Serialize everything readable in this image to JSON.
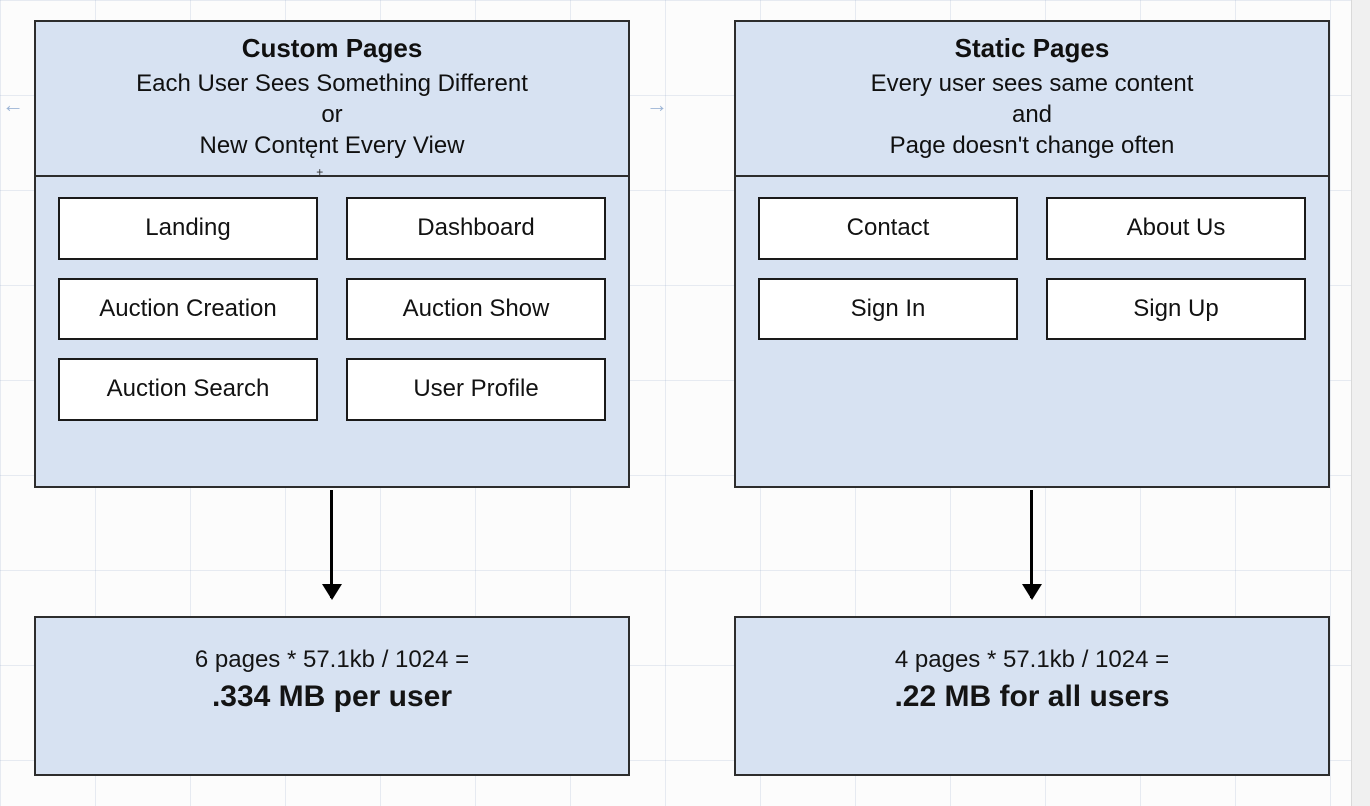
{
  "colors": {
    "panel_fill": "#d7e2f2",
    "panel_border": "#2d2d2d",
    "page_box_fill": "#ffffff",
    "page_box_border": "#1a1a1a",
    "text": "#101010"
  },
  "left": {
    "title": "Custom Pages",
    "sub_line1": "Each User Sees Something Different",
    "sub_or": "or",
    "sub_line2_a": "New Cont",
    "sub_line2_b": "nt Every View",
    "sub_caret_char": "ę",
    "pages": [
      "Landing",
      "Dashboard",
      "Auction Creation",
      "Auction Show",
      "Auction Search",
      "User Profile"
    ],
    "calc_formula": "6 pages * 57.1kb / 1024 =",
    "calc_result": ".334 MB per user"
  },
  "right": {
    "title": "Static Pages",
    "sub_line1": "Every user sees same content",
    "sub_and": "and",
    "sub_line2": "Page doesn't change often",
    "pages": [
      "Contact",
      "About Us",
      "Sign In",
      "Sign Up"
    ],
    "calc_formula": "4 pages * 57.1kb / 1024 =",
    "calc_result": ".22 MB for all users"
  },
  "hint_arrows": {
    "left": "←",
    "right": "→"
  }
}
